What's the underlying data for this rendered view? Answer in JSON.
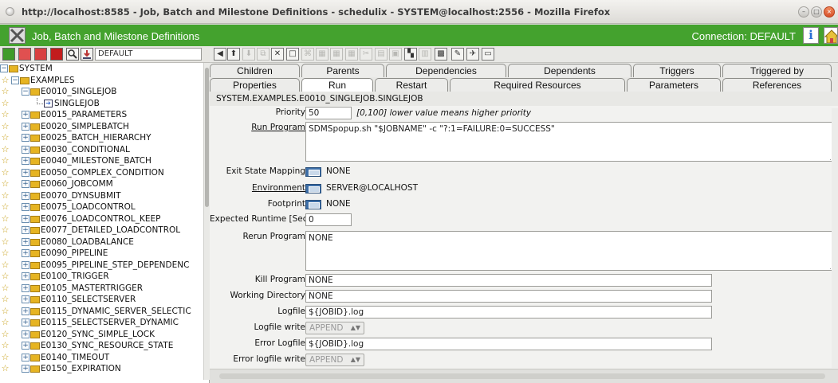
{
  "browser": {
    "title": "http://localhost:8585 - Job, Batch and Milestone Definitions - schedulix - SYSTEM@localhost:2556 - Mozilla Firefox"
  },
  "app": {
    "title": "Job, Batch and Milestone Definitions",
    "connection": "Connection: DEFAULT",
    "info_glyph": "i"
  },
  "tree": {
    "scope_input": "DEFAULT",
    "items": [
      {
        "label": "SYSTEM"
      },
      {
        "label": "EXAMPLES"
      },
      {
        "label": "E0010_SINGLEJOB"
      },
      {
        "label": "SINGLEJOB"
      },
      {
        "label": "E0015_PARAMETERS"
      },
      {
        "label": "E0020_SIMPLEBATCH"
      },
      {
        "label": "E0025_BATCH_HIERARCHY"
      },
      {
        "label": "E0030_CONDITIONAL"
      },
      {
        "label": "E0040_MILESTONE_BATCH"
      },
      {
        "label": "E0050_COMPLEX_CONDITION"
      },
      {
        "label": "E0060_JOBCOMM"
      },
      {
        "label": "E0070_DYNSUBMIT"
      },
      {
        "label": "E0075_LOADCONTROL"
      },
      {
        "label": "E0076_LOADCONTROL_KEEP"
      },
      {
        "label": "E0077_DETAILED_LOADCONTROL"
      },
      {
        "label": "E0080_LOADBALANCE"
      },
      {
        "label": "E0090_PIPELINE"
      },
      {
        "label": "E0095_PIPELINE_STEP_DEPENDENC"
      },
      {
        "label": "E0100_TRIGGER"
      },
      {
        "label": "E0105_MASTERTRIGGER"
      },
      {
        "label": "E0110_SELECTSERVER"
      },
      {
        "label": "E0115_DYNAMIC_SERVER_SELECTIC"
      },
      {
        "label": "E0115_SELECTSERVER_DYNAMIC"
      },
      {
        "label": "E0120_SYNC_SIMPLE_LOCK"
      },
      {
        "label": "E0130_SYNC_RESOURCE_STATE"
      },
      {
        "label": "E0140_TIMEOUT"
      },
      {
        "label": "E0150_EXPIRATION"
      }
    ]
  },
  "tabs_row1": [
    "Children",
    "Parents",
    "Dependencies",
    "Dependents",
    "Triggers",
    "Triggered by"
  ],
  "tabs_row2": [
    "Properties",
    "Run",
    "Restart",
    "Required Resources",
    "Parameters",
    "References"
  ],
  "active_tab": "Run",
  "path": "SYSTEM.EXAMPLES.E0010_SINGLEJOB.SINGLEJOB",
  "form": {
    "priority_label": "Priority",
    "priority_value": "50",
    "priority_hint": "[0,100] lower value means higher priority",
    "run_program_label": "Run Program",
    "run_program_value": "SDMSpopup.sh \"$JOBNAME\" -c \"?:1=FAILURE:0=SUCCESS\"",
    "exit_state_mapping_label": "Exit State Mapping",
    "exit_state_mapping_value": "NONE",
    "environment_label": "Environment",
    "environment_value": "SERVER@LOCALHOST",
    "footprint_label": "Footprint",
    "footprint_value": "NONE",
    "expected_runtime_label": "Expected Runtime [Sec]",
    "expected_runtime_value": "0",
    "rerun_program_label": "Rerun Program",
    "rerun_program_value": "NONE",
    "kill_program_label": "Kill Program",
    "kill_program_value": "NONE",
    "working_directory_label": "Working Directory",
    "working_directory_value": "NONE",
    "logfile_label": "Logfile",
    "logfile_value": "${JOBID}.log",
    "logfile_write_label": "Logfile write",
    "logfile_write_value": "APPEND",
    "error_logfile_label": "Error Logfile",
    "error_logfile_value": "${JOBID}.log",
    "error_logfile_write_label": "Error logfile write",
    "error_logfile_write_value": "APPEND"
  },
  "colors": {
    "app_header": "#44a22e",
    "folder": "#e6b422",
    "browse_button": "#3d6fa8"
  }
}
